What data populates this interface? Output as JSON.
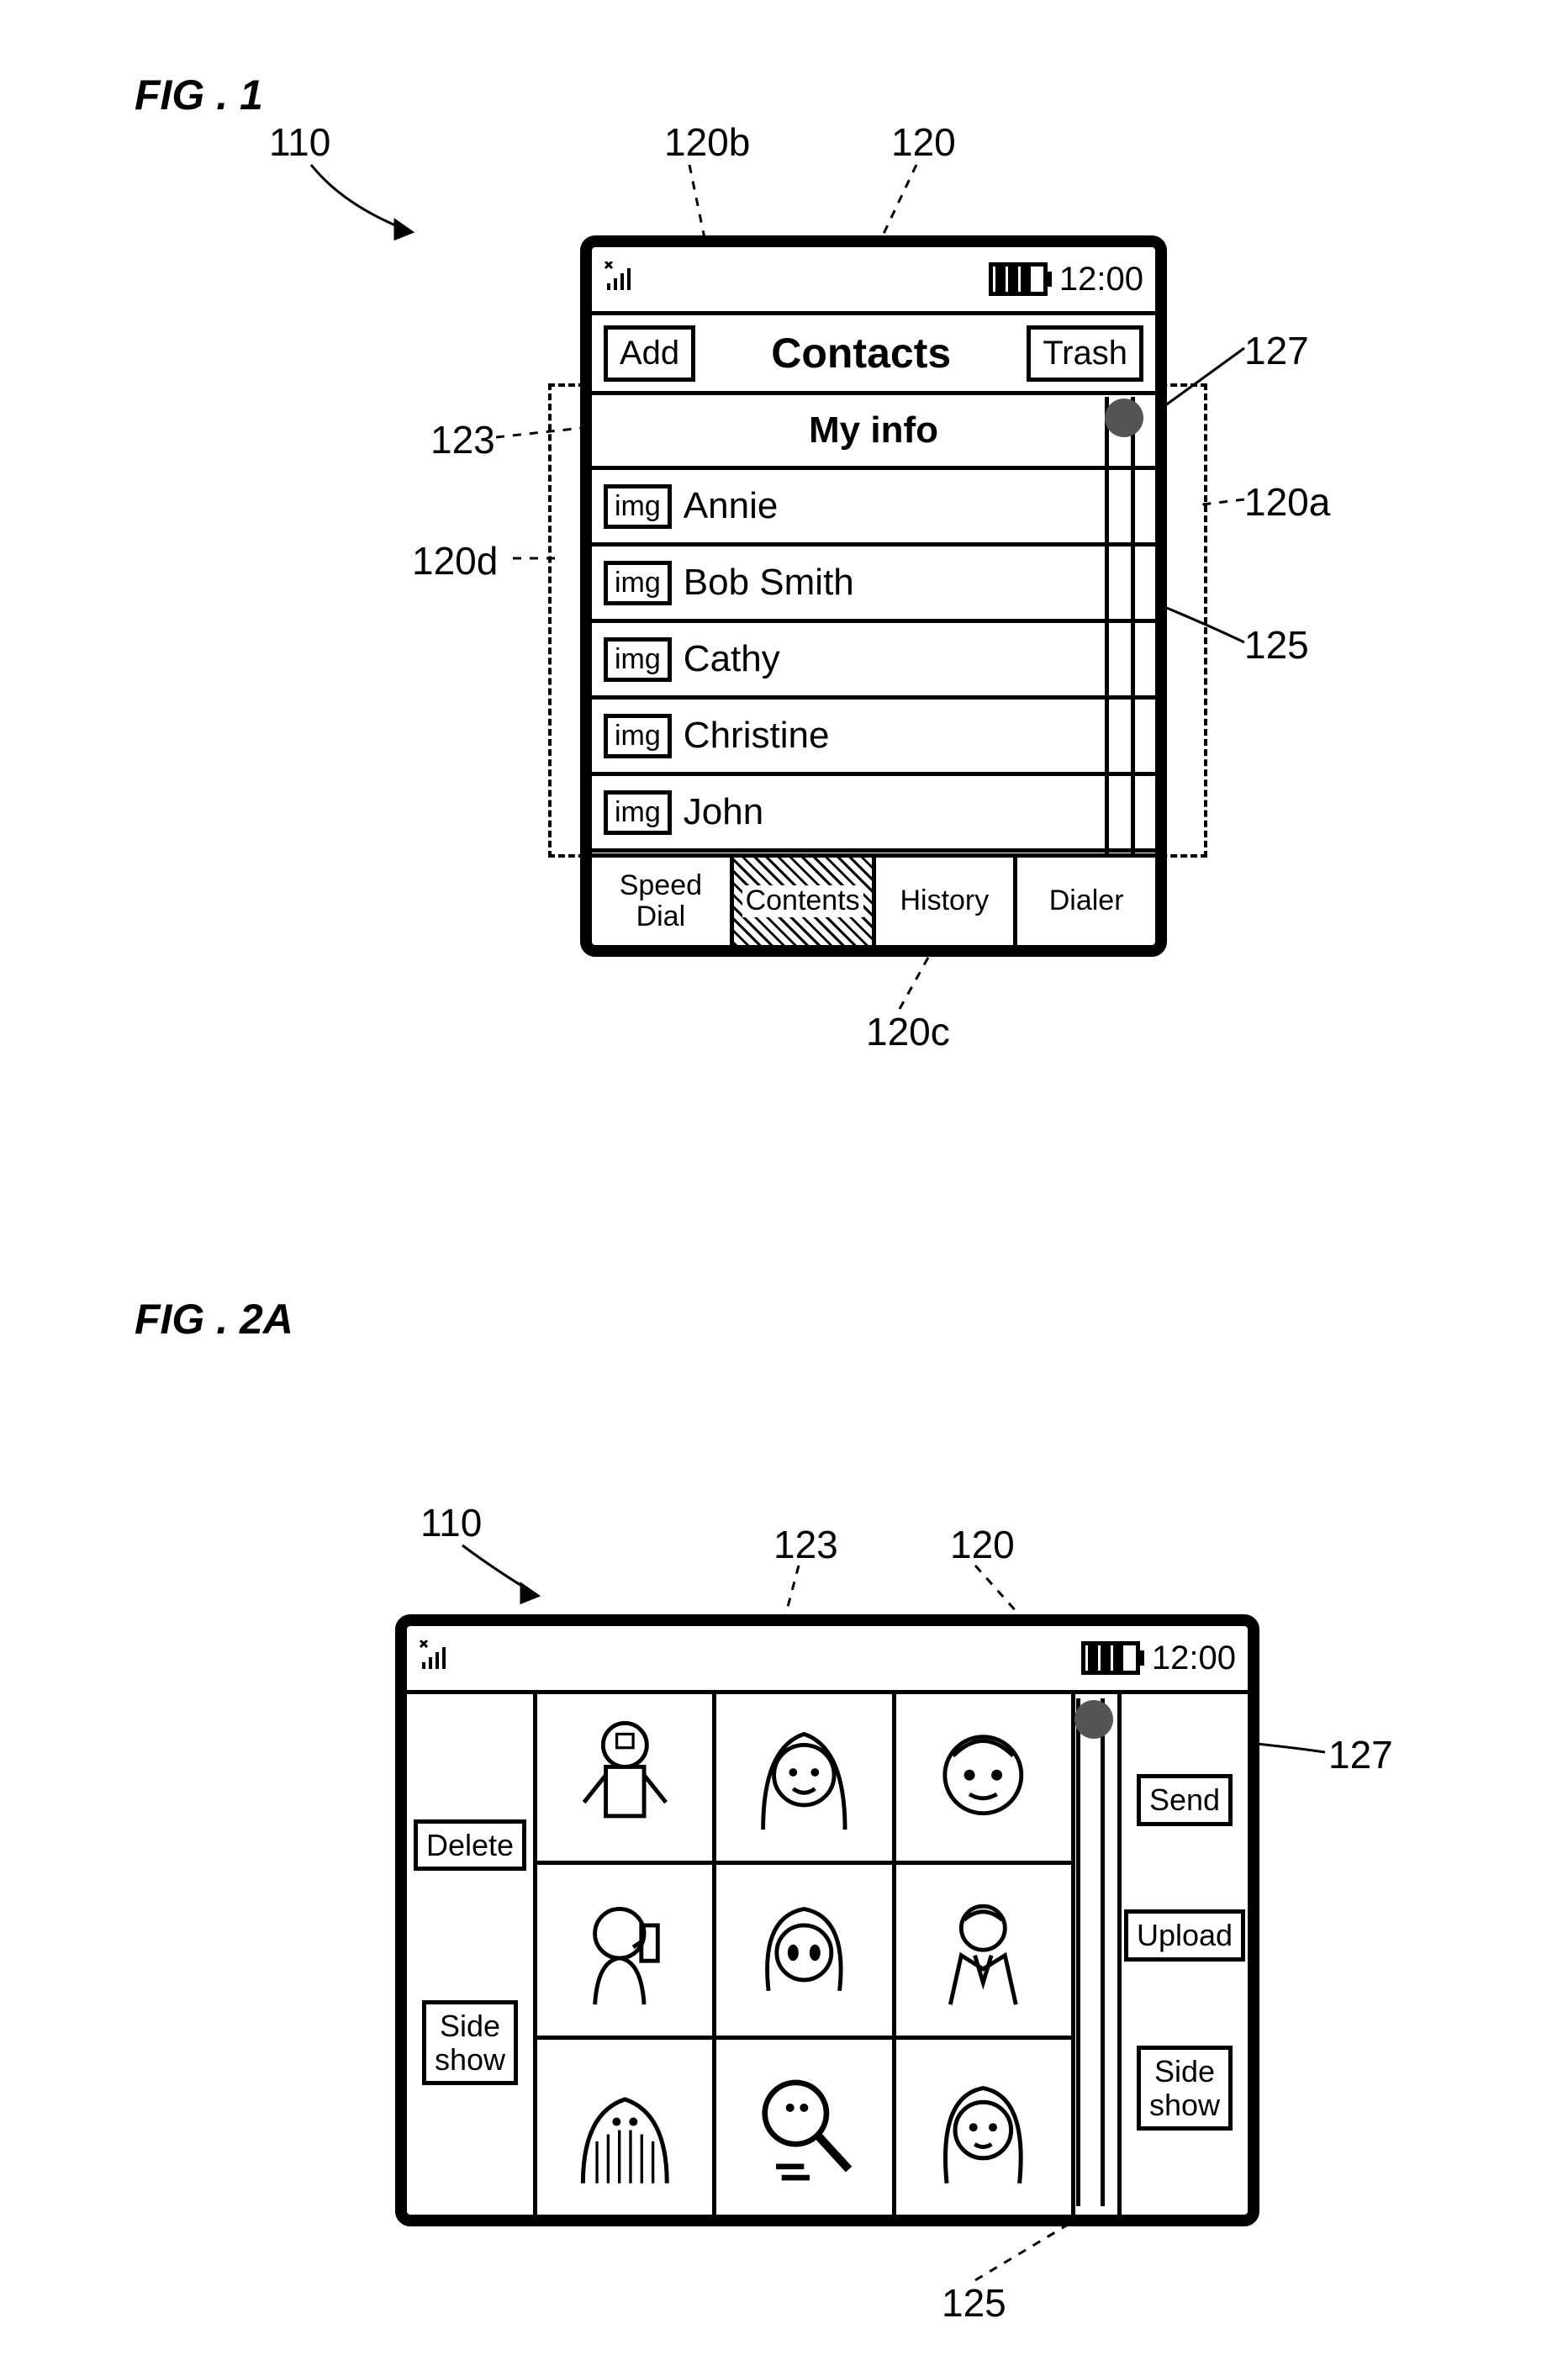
{
  "fig1": {
    "label": "FIG . 1",
    "refs": {
      "r110": "110",
      "r120": "120",
      "r120a": "120a",
      "r120b": "120b",
      "r120c": "120c",
      "r120d": "120d",
      "r123": "123",
      "r125": "125",
      "r127": "127"
    },
    "status": {
      "time": "12:00"
    },
    "toolbar": {
      "add_label": "Add",
      "title": "Contacts",
      "trash_label": "Trash"
    },
    "myinfo_label": "My info",
    "img_placeholder": "img",
    "contacts": [
      {
        "name": "Annie"
      },
      {
        "name": "Bob Smith"
      },
      {
        "name": "Cathy"
      },
      {
        "name": "Christine"
      },
      {
        "name": "John"
      }
    ],
    "tabs": [
      {
        "label": "Speed\nDial",
        "active": false
      },
      {
        "label": "Contents",
        "active": true
      },
      {
        "label": "History",
        "active": false
      },
      {
        "label": "Dialer",
        "active": false
      }
    ]
  },
  "fig2a": {
    "label": "FIG . 2A",
    "refs": {
      "r110": "110",
      "r120": "120",
      "r123": "123",
      "r125": "125",
      "r127": "127"
    },
    "status": {
      "time": "12:00"
    },
    "left_buttons": [
      {
        "label": "Delete"
      },
      {
        "label": "Side\nshow"
      }
    ],
    "right_buttons": [
      {
        "label": "Send"
      },
      {
        "label": "Upload"
      },
      {
        "label": "Side\nshow"
      }
    ],
    "thumbnails": [
      {
        "name": "astronaut"
      },
      {
        "name": "girl-blonde"
      },
      {
        "name": "boy-cartoon"
      },
      {
        "name": "girl-phone"
      },
      {
        "name": "girl-anime"
      },
      {
        "name": "man-suit"
      },
      {
        "name": "dog-shaggy"
      },
      {
        "name": "magnifier-character"
      },
      {
        "name": "girl-redhead"
      }
    ]
  }
}
